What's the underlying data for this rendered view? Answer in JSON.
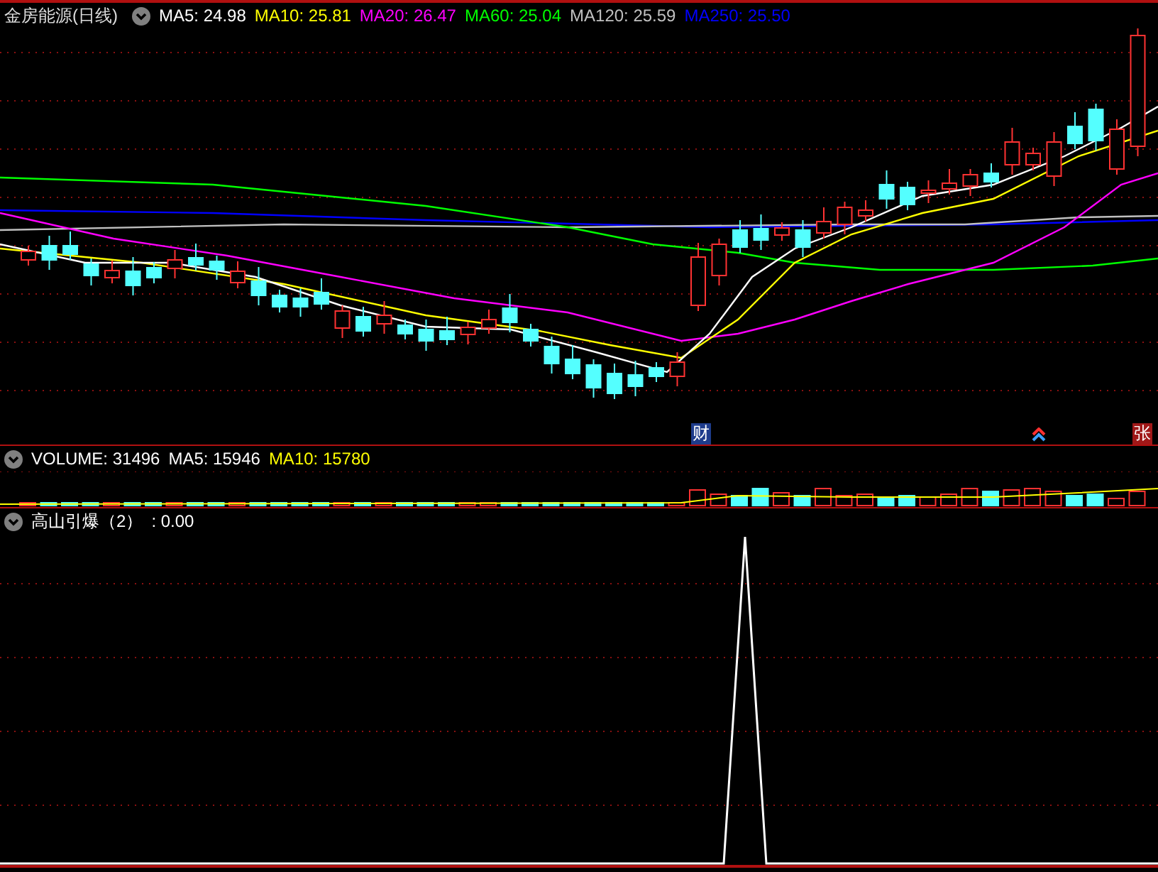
{
  "price_chart": {
    "title": "金房能源(日线)",
    "legend": [
      {
        "label": "MA5: 24.98",
        "color": "#ffffff"
      },
      {
        "label": "MA10: 25.81",
        "color": "#ffff00"
      },
      {
        "label": "MA20: 26.47",
        "color": "#ff00ff"
      },
      {
        "label": "MA60: 25.04",
        "color": "#00ff00"
      },
      {
        "label": "MA120: 25.59",
        "color": "#c0c0c0"
      },
      {
        "label": "MA250: 25.50",
        "color": "#0000ff"
      }
    ],
    "markers": [
      {
        "kind": "text",
        "text": "财",
        "color": "#1e3c8c"
      },
      {
        "kind": "arrow",
        "color": "#ff3030"
      },
      {
        "kind": "text",
        "text": "张",
        "color": "#a01818"
      }
    ]
  },
  "volume_chart": {
    "legend": [
      {
        "label": "VOLUME: 31496",
        "color": "#ffffff"
      },
      {
        "label": "MA5: 15946",
        "color": "#ffffff"
      },
      {
        "label": "MA10: 15780",
        "color": "#ffff00"
      }
    ]
  },
  "indicator_chart": {
    "legend": [
      {
        "label": "高山引爆（2）",
        "color": "#ffffff"
      },
      {
        "label": ": 0.00",
        "color": "#ffffff"
      }
    ]
  }
}
